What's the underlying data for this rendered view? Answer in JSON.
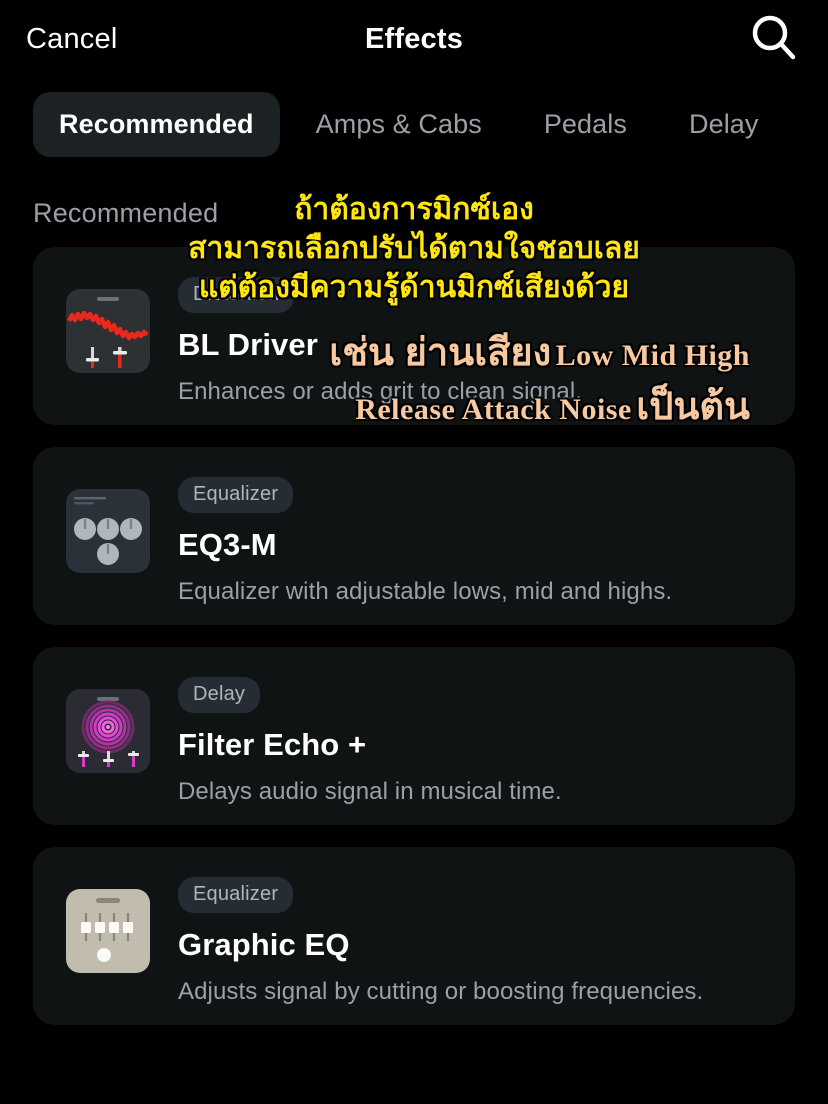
{
  "navbar": {
    "cancel_label": "Cancel",
    "title": "Effects",
    "search_icon": "search-icon"
  },
  "tabs": [
    {
      "label": "Recommended",
      "active": true
    },
    {
      "label": "Amps & Cabs",
      "active": false
    },
    {
      "label": "Pedals",
      "active": false
    },
    {
      "label": "Delay",
      "active": false
    }
  ],
  "section": {
    "header": "Recommended"
  },
  "effects": [
    {
      "badge": "Distortion",
      "title": "BL Driver",
      "description": "Enhances or adds grit to clean signal.",
      "thumb": "distortion-waveform-thumbnail",
      "accent": "#e8291c"
    },
    {
      "badge": "Equalizer",
      "title": "EQ3-M",
      "description": "Equalizer with adjustable lows, mid and highs.",
      "thumb": "equalizer-knobs-thumbnail",
      "accent": "#aeb4bd"
    },
    {
      "badge": "Delay",
      "title": "Filter Echo +",
      "description": "Delays audio signal in musical time.",
      "thumb": "delay-rings-thumbnail",
      "accent": "#d93ad0"
    },
    {
      "badge": "Equalizer",
      "title": "Graphic EQ",
      "description": "Adjusts signal by cutting or boosting frequencies.",
      "thumb": "graphic-eq-sliders-thumbnail",
      "accent": "#ffffff"
    }
  ],
  "overlay": {
    "yellow_color": "#ffe512",
    "orange_color": "#f7c9a0",
    "yellow_lines": [
      "ถ้าต้องการมิกซ์เอง",
      "สามารถเลือกปรับได้ตามใจชอบเลย",
      "แต่ต้องมีความรู้ด้านมิกซ์เสียงด้วย"
    ],
    "orange_line1_thai": "เช่น ย่านเสียง",
    "orange_line1_eng": "Low Mid High",
    "orange_line2_eng": "Release Attack Noise",
    "orange_line2_thai": "เป็นต้น"
  }
}
